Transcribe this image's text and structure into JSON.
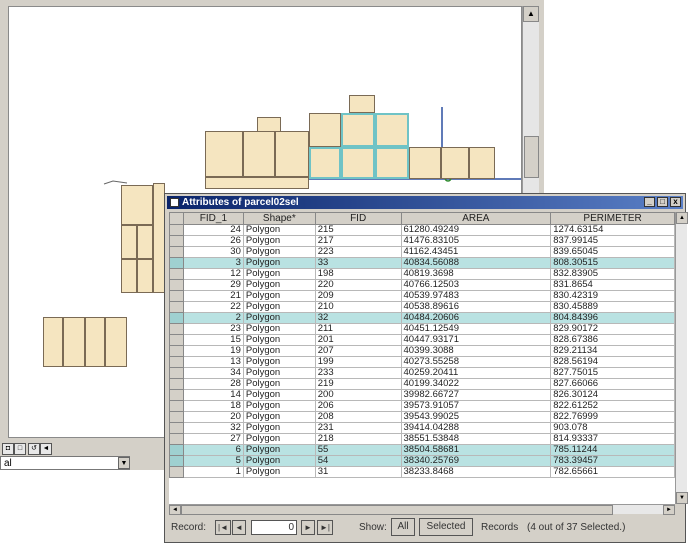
{
  "map": {
    "parcels": "parcel map",
    "scroll_up_glyph": "▲",
    "scroll_down_glyph": "▼",
    "layer_value": "al",
    "layer_dropdown_glyph": "▼",
    "bottom_icons": [
      "◘",
      "□",
      "↺",
      "◄"
    ],
    "highlight_color": "#6fc3c6"
  },
  "table_window": {
    "title": "Attributes of parcel02sel",
    "min_glyph": "_",
    "max_glyph": "□",
    "close_glyph": "x",
    "columns": [
      "FID_1",
      "Shape*",
      "FID",
      "AREA",
      "PERIMETER"
    ],
    "rows": [
      {
        "fid1": "24",
        "shape": "Polygon",
        "fid": "215",
        "area": "61280.49249",
        "perimeter": "1274.63154",
        "selected": false
      },
      {
        "fid1": "26",
        "shape": "Polygon",
        "fid": "217",
        "area": "41476.83105",
        "perimeter": "837.99145",
        "selected": false
      },
      {
        "fid1": "30",
        "shape": "Polygon",
        "fid": "223",
        "area": "41162.43451",
        "perimeter": "839.65045",
        "selected": false
      },
      {
        "fid1": "3",
        "shape": "Polygon",
        "fid": "33",
        "area": "40834.56088",
        "perimeter": "808.30515",
        "selected": true
      },
      {
        "fid1": "12",
        "shape": "Polygon",
        "fid": "198",
        "area": "40819.3698",
        "perimeter": "832.83905",
        "selected": false
      },
      {
        "fid1": "29",
        "shape": "Polygon",
        "fid": "220",
        "area": "40766.12503",
        "perimeter": "831.8654",
        "selected": false
      },
      {
        "fid1": "21",
        "shape": "Polygon",
        "fid": "209",
        "area": "40539.97483",
        "perimeter": "830.42319",
        "selected": false
      },
      {
        "fid1": "22",
        "shape": "Polygon",
        "fid": "210",
        "area": "40538.89616",
        "perimeter": "830.45889",
        "selected": false
      },
      {
        "fid1": "2",
        "shape": "Polygon",
        "fid": "32",
        "area": "40484.20606",
        "perimeter": "804.84396",
        "selected": true
      },
      {
        "fid1": "23",
        "shape": "Polygon",
        "fid": "211",
        "area": "40451.12549",
        "perimeter": "829.90172",
        "selected": false
      },
      {
        "fid1": "15",
        "shape": "Polygon",
        "fid": "201",
        "area": "40447.93171",
        "perimeter": "828.67386",
        "selected": false
      },
      {
        "fid1": "19",
        "shape": "Polygon",
        "fid": "207",
        "area": "40399.3088",
        "perimeter": "829.21134",
        "selected": false
      },
      {
        "fid1": "13",
        "shape": "Polygon",
        "fid": "199",
        "area": "40273.55258",
        "perimeter": "828.56194",
        "selected": false
      },
      {
        "fid1": "34",
        "shape": "Polygon",
        "fid": "233",
        "area": "40259.20411",
        "perimeter": "827.75015",
        "selected": false
      },
      {
        "fid1": "28",
        "shape": "Polygon",
        "fid": "219",
        "area": "40199.34022",
        "perimeter": "827.66066",
        "selected": false
      },
      {
        "fid1": "14",
        "shape": "Polygon",
        "fid": "200",
        "area": "39982.66727",
        "perimeter": "826.30124",
        "selected": false
      },
      {
        "fid1": "18",
        "shape": "Polygon",
        "fid": "206",
        "area": "39573.91057",
        "perimeter": "822.61252",
        "selected": false
      },
      {
        "fid1": "20",
        "shape": "Polygon",
        "fid": "208",
        "area": "39543.99025",
        "perimeter": "822.76999",
        "selected": false
      },
      {
        "fid1": "32",
        "shape": "Polygon",
        "fid": "231",
        "area": "39414.04288",
        "perimeter": "903.078",
        "selected": false
      },
      {
        "fid1": "27",
        "shape": "Polygon",
        "fid": "218",
        "area": "38551.53848",
        "perimeter": "814.93337",
        "selected": false
      },
      {
        "fid1": "6",
        "shape": "Polygon",
        "fid": "55",
        "area": "38504.58681",
        "perimeter": "785.11244",
        "selected": true
      },
      {
        "fid1": "5",
        "shape": "Polygon",
        "fid": "54",
        "area": "38340.25769",
        "perimeter": "783.39457",
        "selected": true
      },
      {
        "fid1": "1",
        "shape": "Polygon",
        "fid": "31",
        "area": "38233.8468",
        "perimeter": "782.65661",
        "selected": false
      }
    ],
    "footer": {
      "record_label": "Record:",
      "first_glyph": "|◄",
      "prev_glyph": "◄",
      "record_value": "0",
      "next_glyph": "►",
      "last_glyph": "►|",
      "show_label": "Show:",
      "all_label": "All",
      "selected_label": "Selected",
      "records_label": "Records",
      "records_status": "(4 out of 37 Selected.)"
    }
  }
}
